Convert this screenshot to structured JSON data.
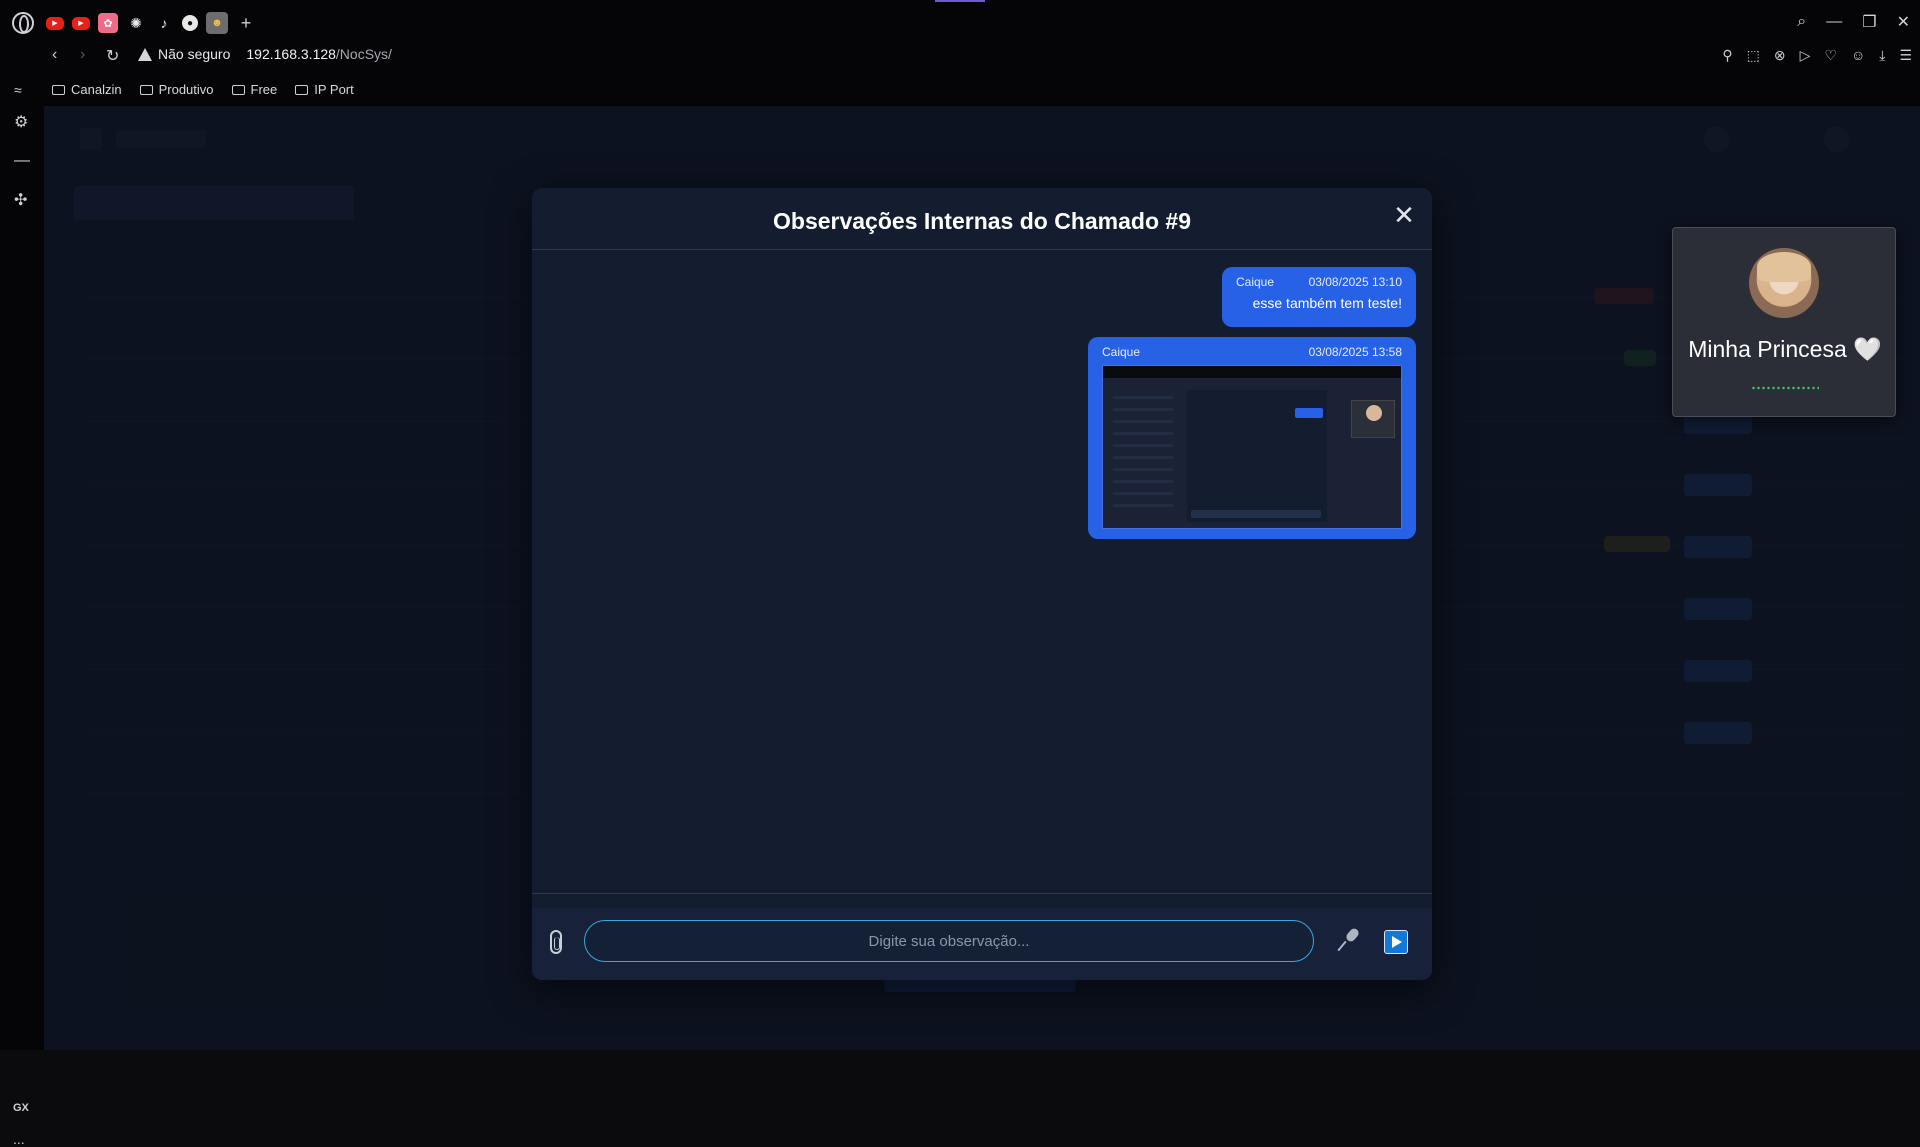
{
  "browser": {
    "security_label": "Não seguro",
    "url_host": "192.168.3.128",
    "url_path": "/NocSys/",
    "bookmarks": [
      "Canalzin",
      "Produtivo",
      "Free",
      "IP Port"
    ],
    "sidebar_brand": "GX",
    "sidebar_more": "..."
  },
  "modal": {
    "title": "Observações Internas do Chamado #9",
    "close_label": "✕",
    "messages": [
      {
        "author": "Caique",
        "timestamp": "03/08/2025 13:10",
        "text": "esse também tem teste!"
      },
      {
        "author": "Caique",
        "timestamp": "03/08/2025 13:58",
        "attachment": "screenshot"
      }
    ],
    "input_placeholder": "Digite sua observação..."
  },
  "pip": {
    "name": "Minha Princesa 🤍"
  },
  "colors": {
    "accent": "#2761e6",
    "modal_bg": "#141d30",
    "page_bg": "#121a2b",
    "input_border": "#3aa7d8"
  }
}
